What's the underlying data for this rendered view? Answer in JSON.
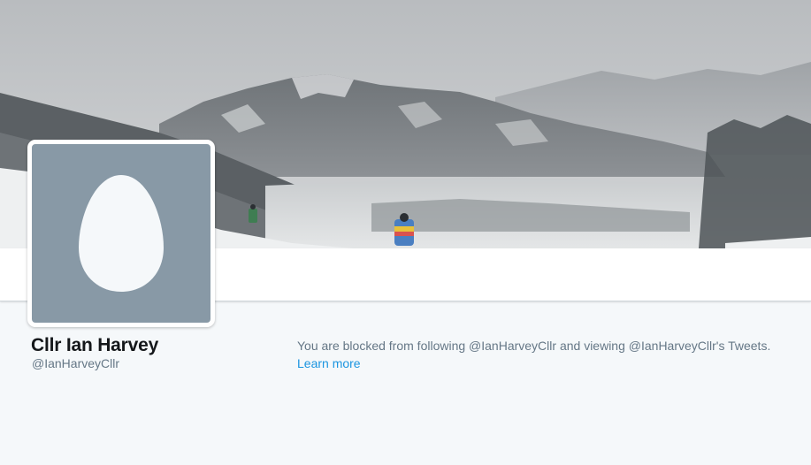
{
  "profile": {
    "name": "Cllr Ian Harvey",
    "handle": "@IanHarveyCllr"
  },
  "blocked": {
    "message": "You are blocked from following @IanHarveyCllr and viewing @IanHarveyCllr's Tweets.",
    "link_label": "Learn more"
  },
  "banner": {
    "description_icon": "header-photo"
  },
  "avatar": {
    "icon": "default-egg-icon"
  },
  "colors": {
    "page_background": "#f5f8fa",
    "avatar_background": "#8899a6",
    "link": "#1b95e0",
    "name_text": "#14171a",
    "muted_text": "#657786"
  }
}
